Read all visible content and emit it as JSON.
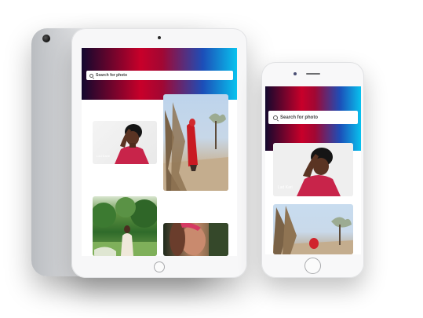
{
  "tablet": {
    "search": {
      "placeholder": "Search for photo"
    },
    "photos": [
      {
        "caption": "Lad Karie"
      },
      {
        "caption": ""
      },
      {
        "caption": ""
      },
      {
        "caption": ""
      }
    ]
  },
  "phone": {
    "search": {
      "placeholder": "Search for photo"
    },
    "photos": [
      {
        "caption": "Lad Kari"
      },
      {
        "caption": ""
      }
    ]
  },
  "colors": {
    "hero_start": "#12082e",
    "hero_red": "#c8002a",
    "hero_blue": "#1c4eb8",
    "hero_end": "#08c2ee"
  }
}
